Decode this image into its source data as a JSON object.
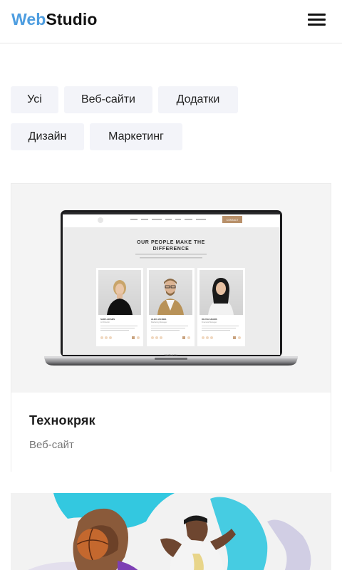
{
  "header": {
    "logo_accent": "Web",
    "logo_rest": "Studio",
    "menu_icon": "hamburger-menu-icon"
  },
  "filters": [
    {
      "label": "Усі"
    },
    {
      "label": "Веб-сайти"
    },
    {
      "label": "Додатки"
    },
    {
      "label": "Дизайн"
    },
    {
      "label": "Маркетинг"
    }
  ],
  "portfolio": [
    {
      "title": "Технокряк",
      "category": "Веб-сайт",
      "image": {
        "heading_line1": "OUR PEOPLE MAKE THE",
        "heading_line2": "DIFFERENCE",
        "button": "CONTACT",
        "base_label": "MacBook Pro",
        "team": [
          {
            "name": "SARA ADAMS",
            "role": "Art Director"
          },
          {
            "name": "ALEX JACOBS",
            "role": "Marketing Manager"
          },
          {
            "name": "OLIVIA ADAMS",
            "role": "Financial Manager"
          }
        ]
      }
    },
    {
      "title": "",
      "category": ""
    }
  ],
  "colors": {
    "accent": "#4d9de0",
    "chip_bg": "#f3f4f9",
    "mockup_button": "#b8906a",
    "splash_cyan": "#33c8e0"
  }
}
